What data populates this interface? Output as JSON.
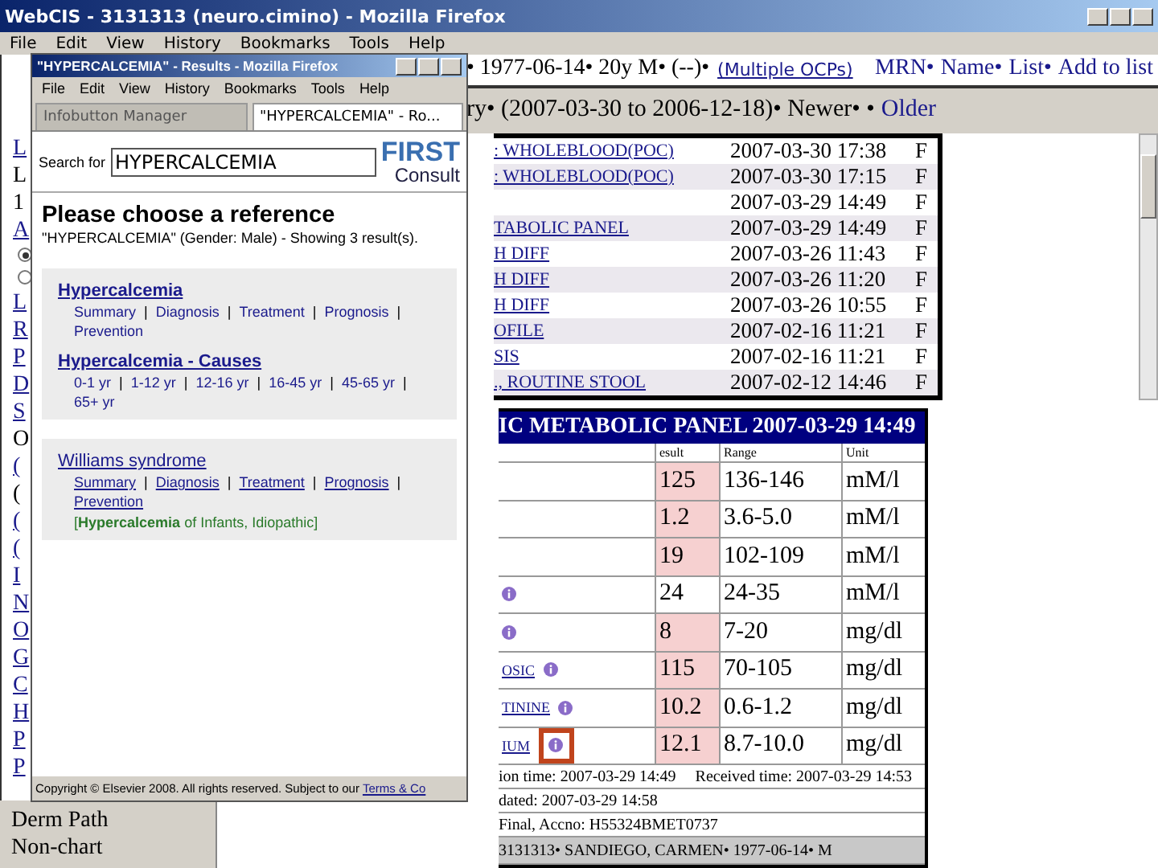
{
  "window": {
    "title": "WebCIS - 3131313 (neuro.cimino) - Mozilla Firefox",
    "menu": [
      "File",
      "Edit",
      "View",
      "History",
      "Bookmarks",
      "Tools",
      "Help"
    ]
  },
  "sidebar": {
    "items": [
      {
        "kind": "link",
        "text": "L"
      },
      {
        "kind": "text",
        "text": "L"
      },
      {
        "kind": "text",
        "text": "1"
      },
      {
        "kind": "link",
        "text": "A"
      },
      {
        "kind": "radio",
        "selected": true
      },
      {
        "kind": "radio",
        "selected": false
      },
      {
        "kind": "link",
        "text": "L"
      },
      {
        "kind": "link",
        "text": "R"
      },
      {
        "kind": "link",
        "text": "P"
      },
      {
        "kind": "link",
        "text": "D"
      },
      {
        "kind": "link",
        "text": "S"
      },
      {
        "kind": "text",
        "text": "O"
      },
      {
        "kind": "link",
        "text": "("
      },
      {
        "kind": "text",
        "text": "("
      },
      {
        "kind": "link",
        "text": "("
      },
      {
        "kind": "link",
        "text": "("
      },
      {
        "kind": "link",
        "text": "I"
      },
      {
        "kind": "link",
        "text": "N"
      },
      {
        "kind": "link",
        "text": "O"
      },
      {
        "kind": "link",
        "text": "G"
      },
      {
        "kind": "link",
        "text": "C"
      },
      {
        "kind": "link",
        "text": "H"
      },
      {
        "kind": "link",
        "text": "P"
      },
      {
        "kind": "link",
        "text": "P"
      }
    ],
    "bottom_items": [
      "Derm Path",
      "Non-chart"
    ]
  },
  "patient_bar": {
    "demographics": "• 1977-06-14• 20y M• (--)•",
    "ocps": "(Multiple OCPs)",
    "links": [
      "MRN•",
      "Name•",
      "List•",
      "Add to list"
    ]
  },
  "results_header": {
    "text": "ry• (2007-03-30 to 2006-12-18)• Newer• •",
    "older": "Older"
  },
  "results": [
    {
      "name": ": WHOLEBLOOD(POC)",
      "time": "2007-03-30 17:38",
      "status": "F"
    },
    {
      "name": ": WHOLEBLOOD(POC)",
      "time": "2007-03-30 17:15",
      "status": "F"
    },
    {
      "time": "2007-03-29 14:49",
      "status": "F"
    },
    {
      "name": "TABOLIC PANEL",
      "time": "2007-03-29 14:49",
      "status": "F"
    },
    {
      "name": "H DIFF",
      "time": "2007-03-26 11:43",
      "status": "F"
    },
    {
      "name": "H DIFF",
      "time": "2007-03-26 11:20",
      "status": "F"
    },
    {
      "name": "H DIFF",
      "time": "2007-03-26 10:55",
      "status": "F"
    },
    {
      "name": "OFILE",
      "time": "2007-02-16 11:21",
      "status": "F"
    },
    {
      "name": "SIS",
      "time": "2007-02-16 11:21",
      "status": "F"
    },
    {
      "name": "., ROUTINE STOOL",
      "time": "2007-02-12 14:46",
      "status": "F"
    }
  ],
  "lab_panel": {
    "title": "IC METABOLIC PANEL 2007-03-29 14:49",
    "columns": [
      "esult",
      "Range",
      "Unit"
    ],
    "rows": [
      {
        "result": "125",
        "range": "136-146",
        "unit": "mM/l",
        "abnormal": true,
        "info": false,
        "highlighted": false
      },
      {
        "result": "1.2",
        "range": "3.6-5.0",
        "unit": "mM/l",
        "abnormal": true,
        "info": false,
        "highlighted": false
      },
      {
        "result": "19",
        "range": "102-109",
        "unit": "mM/l",
        "abnormal": true,
        "info": false,
        "highlighted": false
      },
      {
        "result": "24",
        "range": "24-35",
        "unit": "mM/l",
        "abnormal": false,
        "info": true,
        "highlighted": false
      },
      {
        "result": "8",
        "range": "7-20",
        "unit": "mg/dl",
        "abnormal": true,
        "info": true,
        "highlighted": false
      },
      {
        "test": "OSIC",
        "result": "115",
        "range": "70-105",
        "unit": "mg/dl",
        "abnormal": true,
        "info": true,
        "highlighted": false
      },
      {
        "test": "TININE",
        "result": "10.2",
        "range": "0.6-1.2",
        "unit": "mg/dl",
        "abnormal": true,
        "info": true,
        "highlighted": false
      },
      {
        "test": "IUM",
        "result": "12.1",
        "range": "8.7-10.0",
        "unit": "mg/dl",
        "abnormal": true,
        "info": true,
        "highlighted": true
      }
    ],
    "collection_time": "ion time: 2007-03-29 14:49",
    "received_time": "Received time: 2007-03-29 14:53",
    "updated": "dated: 2007-03-29 14:58",
    "accession": "Final, Accno: H55324BMET0737",
    "patient": "3131313• SANDIEGO, CARMEN• 1977-06-14• M"
  },
  "popup": {
    "title": "\"HYPERCALCEMIA\" - Results - Mozilla Firefox",
    "menu": [
      "File",
      "Edit",
      "View",
      "History",
      "Bookmarks",
      "Tools",
      "Help"
    ],
    "tabs": [
      {
        "label": "Infobutton Manager",
        "selected": false
      },
      {
        "label": "\"HYPERCALCEMIA\" - Ro...",
        "selected": true
      }
    ],
    "search_label": "Search for",
    "search_value": "HYPERCALCEMIA",
    "logo_top": "FIRST",
    "logo_bottom": "Consult",
    "heading": "Please choose a reference",
    "subtitle": "\"HYPERCALCEMIA\" (Gender: Male) - Showing 3 result(s).",
    "separator": "|",
    "cards": [
      {
        "items": [
          {
            "kind": "topic",
            "title": "Hypercalcemia",
            "links": [
              "Summary",
              "Diagnosis",
              "Treatment",
              "Prognosis",
              "Prevention"
            ]
          },
          {
            "kind": "topic",
            "title": "Hypercalcemia - Causes",
            "links": [
              "0-1 yr",
              "1-12 yr",
              "12-16 yr",
              "16-45 yr",
              "45-65 yr",
              "65+ yr"
            ]
          }
        ]
      },
      {
        "items": [
          {
            "kind": "related",
            "title": "Williams syndrome",
            "links": [
              "Summary",
              "Diagnosis",
              "Treatment",
              "Prognosis",
              "Prevention"
            ],
            "note": "[**Hypercalcemia** of Infants, Idiopathic]"
          }
        ]
      }
    ],
    "copyright": "Copyright © Elsevier 2008. All rights reserved. Subject to our",
    "terms": "Terms & Co"
  }
}
